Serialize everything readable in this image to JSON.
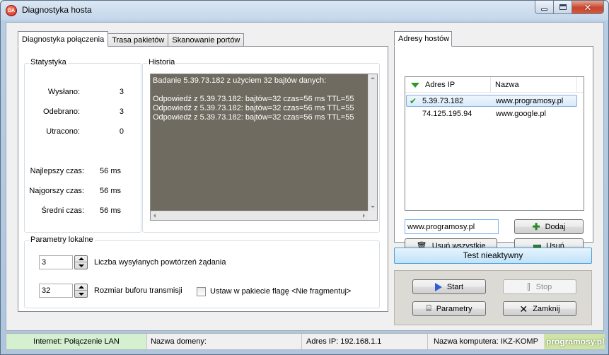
{
  "window": {
    "title": "Diagnostyka hosta",
    "icon_text": "DA"
  },
  "tabs": [
    {
      "label": "Diagnostyka połączenia",
      "active": true
    },
    {
      "label": "Trasa pakietów",
      "active": false
    },
    {
      "label": "Skanowanie portów",
      "active": false
    }
  ],
  "stats": {
    "legend": "Statystyka",
    "rows": [
      {
        "label": "Wysłano:",
        "value": "3"
      },
      {
        "label": "Odebrano:",
        "value": "3"
      },
      {
        "label": "Utracono:",
        "value": "0"
      },
      {
        "label": "Najlepszy czas:",
        "value": "56 ms"
      },
      {
        "label": "Najgorszy czas:",
        "value": "56 ms"
      },
      {
        "label": "Średni czas:",
        "value": "56 ms"
      }
    ]
  },
  "history": {
    "legend": "Historia",
    "text": "Badanie 5.39.73.182 z użyciem 32 bajtów danych:\n\nOdpowiedź z 5.39.73.182: bajtów=32 czas=56 ms TTL=55\nOdpowiedź z 5.39.73.182: bajtów=32 czas=56 ms TTL=55\nOdpowiedź z 5.39.73.182: bajtów=32 czas=56 ms TTL=55"
  },
  "local_params": {
    "legend": "Parametry lokalne",
    "repeat_count": "3",
    "repeat_label": "Liczba wysyłanych powtórzeń żądania",
    "buffer_size": "32",
    "buffer_label": "Rozmiar buforu transmisji",
    "dont_fragment_label": "Ustaw w pakiecie flagę <Nie fragmentuj>",
    "dont_fragment_checked": false
  },
  "hosts": {
    "tab_label": "Adresy hostów",
    "columns": [
      "Adres IP",
      "Nazwa"
    ],
    "rows": [
      {
        "ip": "5.39.73.182",
        "name": "www.programosy.pl",
        "selected": true,
        "checked": true
      },
      {
        "ip": "74.125.195.94",
        "name": "www.google.pl",
        "selected": false,
        "checked": false
      }
    ],
    "input_value": "www.programosy.pl",
    "add_label": "Dodaj",
    "remove_all_label": "Usuń wszystkie",
    "remove_label": "Usuń"
  },
  "test_status": "Test nieaktywny",
  "actions": {
    "start_label": "Start",
    "stop_label": "Stop",
    "params_label": "Parametry",
    "close_label": "Zamknij"
  },
  "statusbar": {
    "internet": "Internet: Połączenie LAN",
    "domain": "Nazwa domeny:",
    "ip": "Adres IP: 192.168.1.1",
    "computer": "Nazwa komputera: IKZ-KOMP"
  },
  "watermark": "programosy.pl",
  "colors": {
    "history_bg": "#6f6b60",
    "internet_status_bg": "#d5f0d0",
    "test_status_bg": "#bfe2f9",
    "sort_arrow": "#2a9a2a"
  }
}
